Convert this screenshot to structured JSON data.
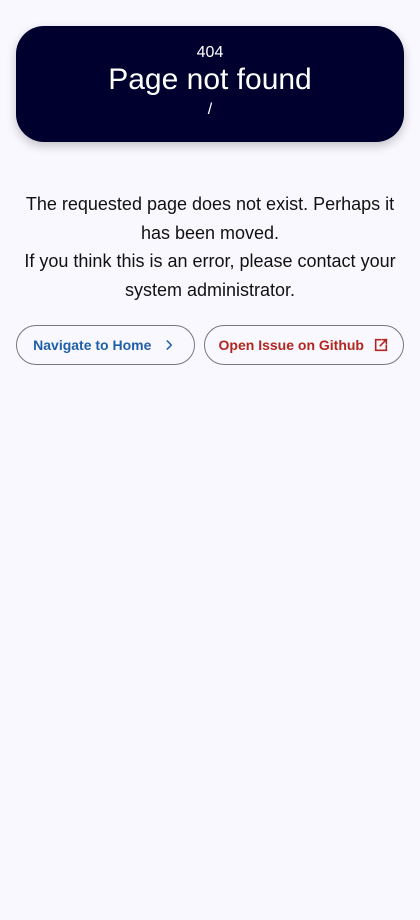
{
  "error": {
    "code": "404",
    "title": "Page not found",
    "path": "/"
  },
  "message": {
    "line1": "The requested page does not exist. Perhaps it has been moved.",
    "line2": "If you think this is an error, please contact your system administrator."
  },
  "actions": {
    "home_label": "Navigate to Home",
    "home_icon": "chevron-right-icon",
    "github_label": "Open Issue on Github",
    "github_icon": "external-link-icon"
  },
  "colors": {
    "hero_background": "#00002e",
    "page_background": "#f9f8fe",
    "home_accent": "#1f5fa8",
    "github_accent": "#b3261e"
  }
}
